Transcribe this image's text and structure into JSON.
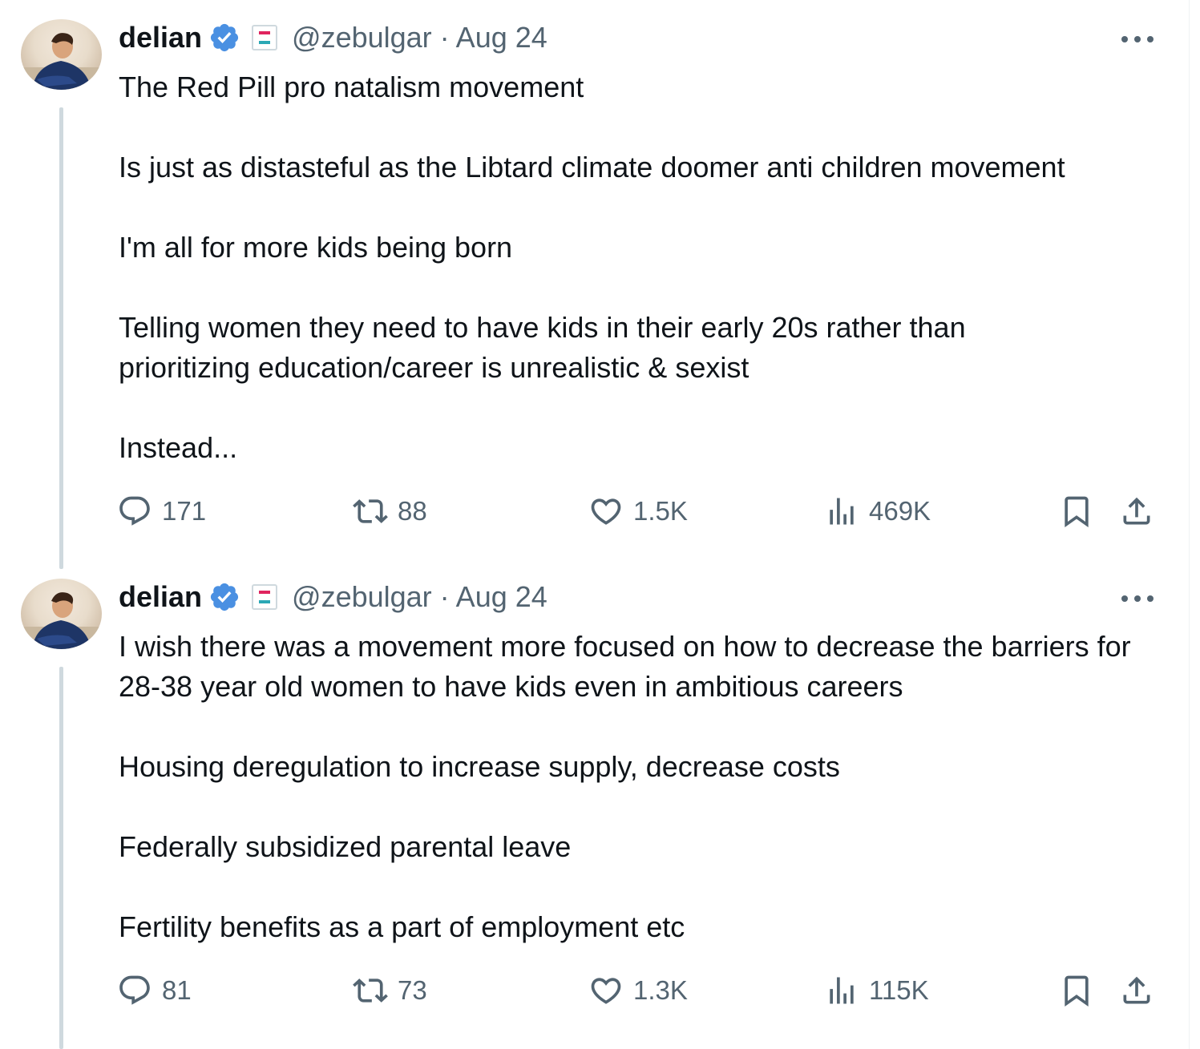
{
  "tweets": [
    {
      "author_name": "delian",
      "handle_date": "@zebulgar · Aug 24",
      "paragraphs": [
        "The Red Pill pro natalism movement",
        "Is just as distasteful as the Libtard climate doomer anti children movement",
        "I'm all for more kids being born",
        "Telling women they need to have kids in their early 20s rather than prioritizing education/career is unrealistic & sexist",
        "Instead..."
      ],
      "replies": "171",
      "reposts": "88",
      "likes": "1.5K",
      "views": "469K"
    },
    {
      "author_name": "delian",
      "handle_date": "@zebulgar · Aug 24",
      "paragraphs": [
        "I wish there was a movement more focused on how to decrease the barriers for 28-38 year old women to have kids even in ambitious careers",
        "Housing deregulation to increase supply, decrease costs",
        "Federally subsidized parental leave",
        "Fertility benefits as a part of employment etc"
      ],
      "replies": "81",
      "reposts": "73",
      "likes": "1.3K",
      "views": "115K"
    }
  ],
  "icons": {
    "verified": "verified-badge-icon",
    "flag": "flag-icon",
    "more": "more-options-icon",
    "reply": "reply-icon",
    "repost": "repost-icon",
    "like": "heart-icon",
    "views": "views-icon",
    "bookmark": "bookmark-icon",
    "share": "share-icon"
  },
  "colors": {
    "text": "#0f1419",
    "secondary": "#536471",
    "verified": "#4a90e2",
    "thread_line": "#cfd9de"
  }
}
